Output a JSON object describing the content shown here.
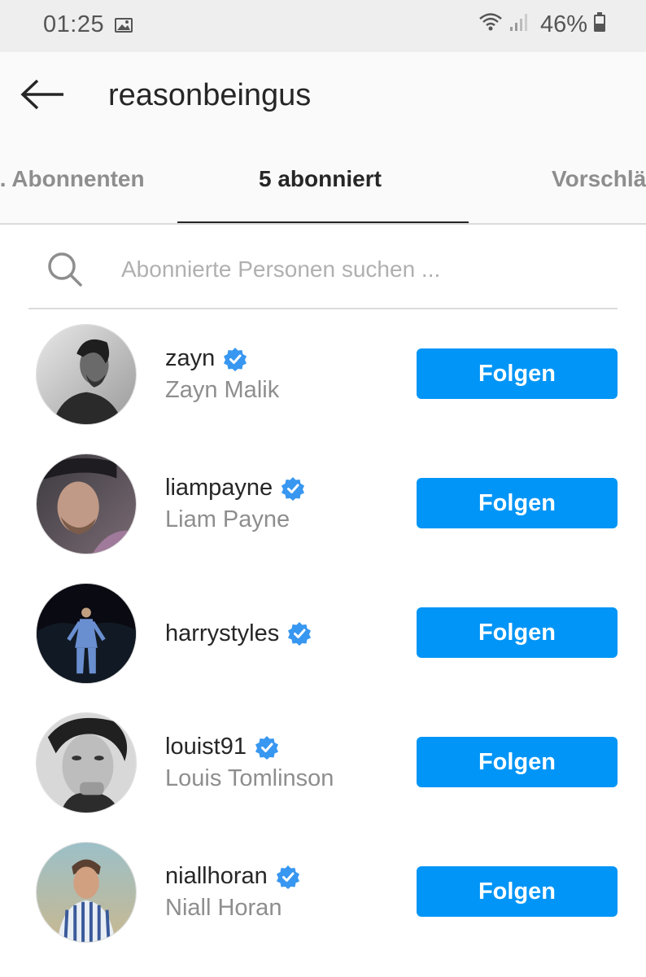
{
  "status_bar": {
    "time": "01:25",
    "battery_percent": "46%",
    "icons": [
      "image-icon",
      "wifi-icon",
      "signal-icon",
      "battery-icon"
    ]
  },
  "header": {
    "title": "reasonbeingus",
    "back_icon": "back-arrow-icon"
  },
  "tabs": [
    {
      "label": "l. Abonnenten",
      "active": false
    },
    {
      "label": "5 abonniert",
      "active": true
    },
    {
      "label": "Vorschlä",
      "active": false
    }
  ],
  "search": {
    "placeholder": "Abonnierte Personen suchen ...",
    "value": ""
  },
  "users": [
    {
      "username": "zayn",
      "full_name": "Zayn Malik",
      "verified": true,
      "button": "Folgen"
    },
    {
      "username": "liampayne",
      "full_name": "Liam Payne",
      "verified": true,
      "button": "Folgen"
    },
    {
      "username": "harrystyles",
      "full_name": "",
      "verified": true,
      "button": "Folgen"
    },
    {
      "username": "louist91",
      "full_name": "Louis Tomlinson",
      "verified": true,
      "button": "Folgen"
    },
    {
      "username": "niallhoran",
      "full_name": "Niall Horan",
      "verified": true,
      "button": "Folgen"
    }
  ],
  "colors": {
    "accent": "#0095f6",
    "verified": "#3897f0",
    "text_primary": "#262626",
    "text_secondary": "#8e8e8e"
  }
}
